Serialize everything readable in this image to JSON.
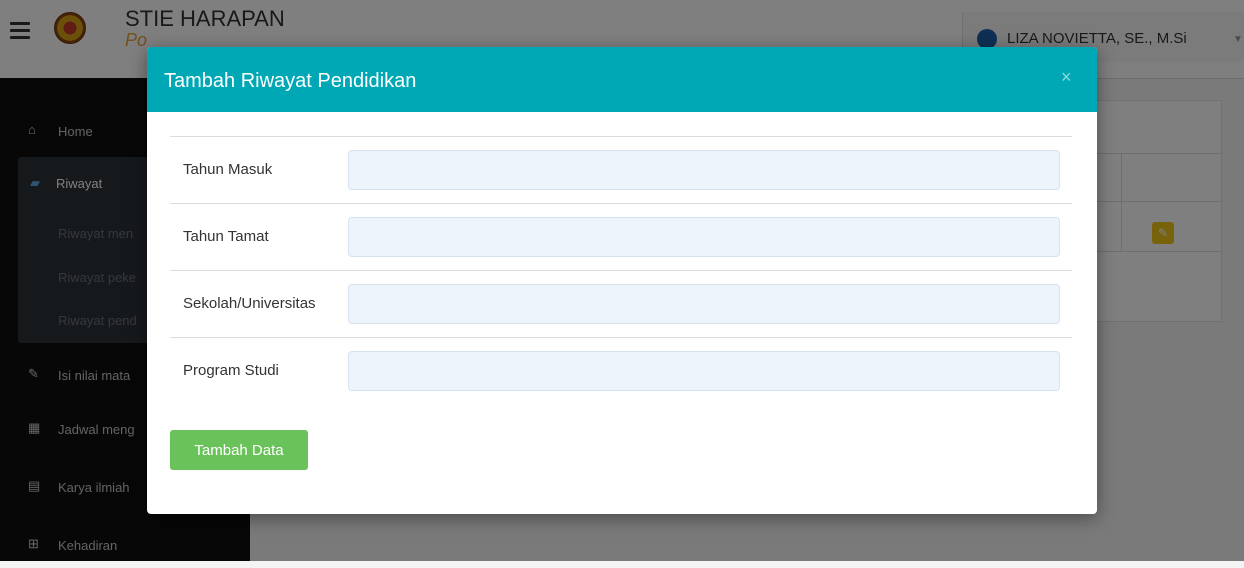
{
  "topbar": {
    "brand_title": "STIE HARAPAN",
    "brand_subtitle": "Po",
    "user_name": "LIZA NOVIETTA, SE., M.Si",
    "menu_icon": "hamburger-icon",
    "caret_icon": "caret-down-icon"
  },
  "sidebar": {
    "items": [
      {
        "label": "Home",
        "icon": "home-icon"
      },
      {
        "label": "Isi nilai mata",
        "icon": "edit-icon"
      },
      {
        "label": "Jadwal meng",
        "icon": "calendar-icon"
      },
      {
        "label": "Karya ilmiah",
        "icon": "file-icon"
      },
      {
        "label": "Kehadiran",
        "icon": "table-icon"
      }
    ],
    "riwayat": {
      "label": "Riwayat",
      "icon": "book-icon",
      "children": [
        "Riwayat men",
        "Riwayat peke",
        "Riwayat pend"
      ]
    }
  },
  "modal": {
    "title": "Tambah Riwayat Pendidikan",
    "close_symbol": "×",
    "fields": [
      {
        "label": "Tahun Masuk",
        "value": "",
        "placeholder": ""
      },
      {
        "label": "Tahun Tamat",
        "value": "",
        "placeholder": ""
      },
      {
        "label": "Sekolah/Universitas",
        "value": "",
        "placeholder": ""
      },
      {
        "label": "Program Studi",
        "value": "",
        "placeholder": ""
      }
    ],
    "submit_label": "Tambah Data"
  },
  "colors": {
    "modal_header": "#00a8b5",
    "submit_button": "#6ac25a",
    "edit_button": "#f0c419"
  }
}
